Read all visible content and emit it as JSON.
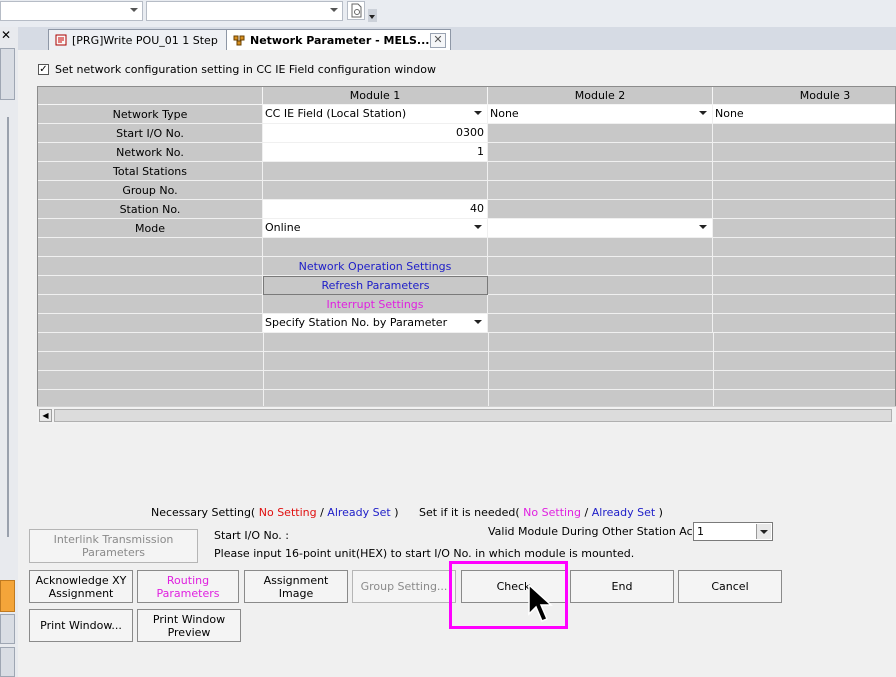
{
  "tabs": [
    {
      "label": "[PRG]Write POU_01 1 Step"
    },
    {
      "label": "Network Parameter - MELS..."
    }
  ],
  "close_glyph": "✕",
  "settings_checkbox": {
    "label": "Set network configuration setting in CC IE Field configuration window",
    "checked": true
  },
  "grid": {
    "columns": [
      "Module 1",
      "Module 2",
      "Module 3"
    ],
    "rows": {
      "network_type": {
        "label": "Network Type",
        "m1": "CC IE Field (Local Station)",
        "m2": "None",
        "m3": "None"
      },
      "start_io": {
        "label": "Start I/O No.",
        "m1": "0300"
      },
      "network_no": {
        "label": "Network No.",
        "m1": "1"
      },
      "total_stations": {
        "label": "Total Stations"
      },
      "group_no": {
        "label": "Group No."
      },
      "station_no": {
        "label": "Station No.",
        "m1": "40"
      },
      "mode": {
        "label": "Mode",
        "m1": "Online"
      },
      "network_operation": "Network Operation Settings",
      "refresh_params": "Refresh Parameters",
      "interrupt_settings": "Interrupt Settings",
      "specify_station": "Specify Station No. by Parameter"
    }
  },
  "legend": {
    "necessary_prefix": "Necessary Setting(",
    "set_if_needed_prefix": "Set if it is needed(",
    "no_setting": "No Setting",
    "slash": "/",
    "already_set": "Already Set",
    "close_paren": ")"
  },
  "valid_module": {
    "label": "Valid Module During Other Station Access",
    "value": "1"
  },
  "info": {
    "start_io_label": "Start I/O No. :",
    "start_io_hint": "Please input 16-point unit(HEX) to start I/O No. in which module is mounted."
  },
  "buttons": {
    "interlink": "Interlink Transmission Parameters",
    "acknowledge_xy": "Acknowledge XY Assignment",
    "routing": "Routing Parameters",
    "assignment_image": "Assignment Image",
    "group_setting": "Group Setting...",
    "check": "Check",
    "end": "End",
    "cancel": "Cancel",
    "print_window": "Print Window...",
    "print_preview": "Print Window Preview"
  },
  "colors": {
    "highlight": "#ff00ff",
    "link_blue": "#1d1dc8",
    "link_magenta": "#e020e0",
    "no_setting_red": "#e01010"
  }
}
